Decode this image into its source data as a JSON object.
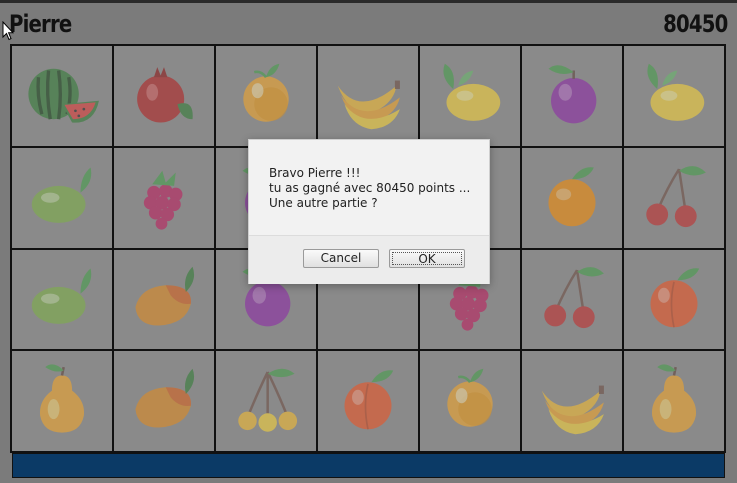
{
  "header": {
    "player_name": "Pierre",
    "score": "80450"
  },
  "board": {
    "rows": [
      [
        "watermelon-icon",
        "pomegranate-icon",
        "apricot-icon",
        "banana-icon",
        "lemon-icon",
        "plum-icon",
        "lemon-icon"
      ],
      [
        "lime-icon",
        "raspberry-icon",
        "plum-icon",
        "",
        "",
        "orange-icon",
        "cherry-icon"
      ],
      [
        "lime-icon",
        "mango-icon",
        "plum-icon",
        "",
        "raspberry-icon",
        "cherry-icon",
        "peach-icon"
      ],
      [
        "pear-icon",
        "mango-icon",
        "yellow-cherry-icon",
        "peach-icon",
        "apricot-icon",
        "banana-icon",
        "pear-icon"
      ]
    ]
  },
  "dialog": {
    "line1": "Bravo Pierre !!!",
    "line2": "tu as gagné avec 80450 points ...",
    "line3": "Une autre partie ?",
    "cancel_label": "Cancel",
    "ok_label": "OK"
  },
  "colors": {
    "overlay": "#7b7b7b",
    "bottom_bar": "#0b3a66"
  }
}
